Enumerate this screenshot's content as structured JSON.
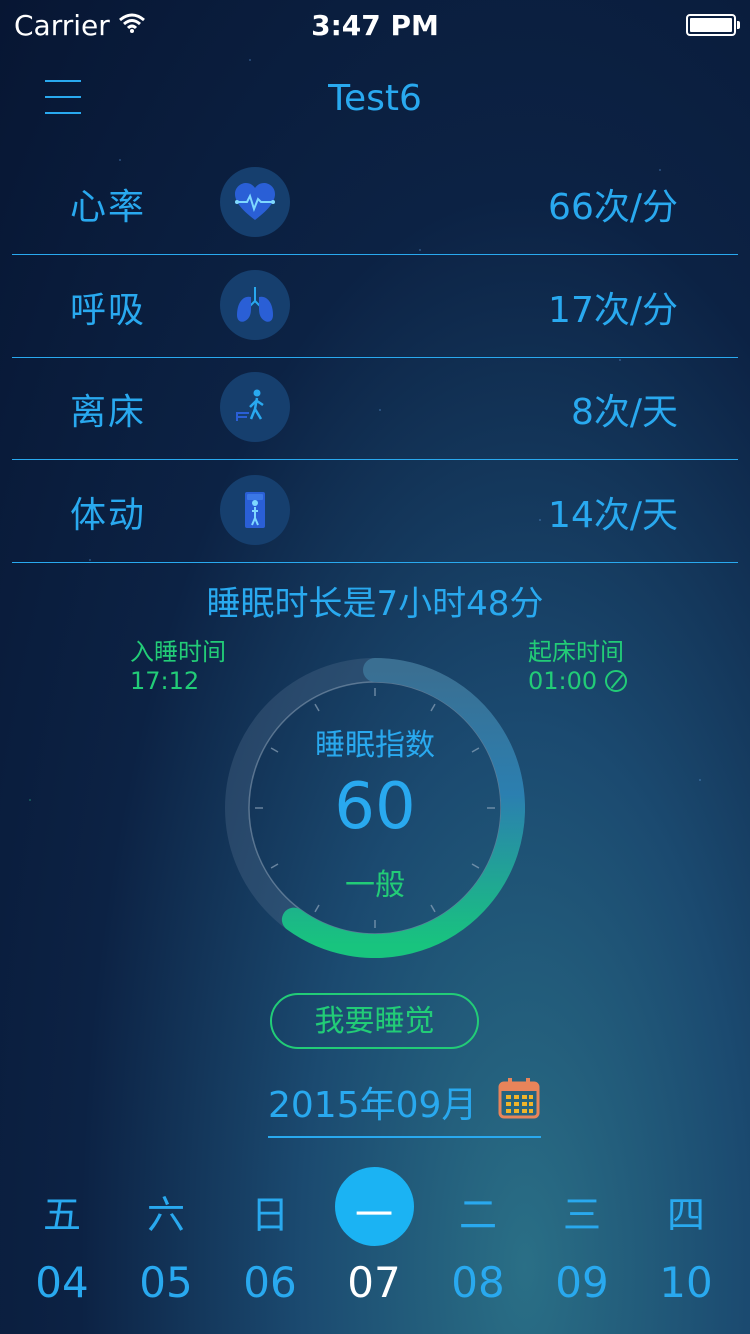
{
  "status": {
    "carrier": "Carrier",
    "time": "3:47 PM"
  },
  "nav": {
    "title": "Test6"
  },
  "metrics": [
    {
      "label": "心率",
      "icon": "heart-icon",
      "value": "66次/分"
    },
    {
      "label": "呼吸",
      "icon": "lungs-icon",
      "value": "17次/分"
    },
    {
      "label": "离床",
      "icon": "walking-person-icon",
      "value": "8次/天"
    },
    {
      "label": "体动",
      "icon": "person-in-bed-icon",
      "value": "14次/天"
    }
  ],
  "sleep": {
    "duration": "睡眠时长是7小时48分",
    "bedtime_label": "入睡时间",
    "bedtime": "17:12",
    "wake_label": "起床时间",
    "wake_time": "01:00"
  },
  "gauge": {
    "title": "睡眠指数",
    "score": "60",
    "grade": "一般",
    "score_value": 60,
    "max": 100
  },
  "sleep_button": "我要睡觉",
  "month": "2015年09月",
  "week": [
    {
      "dow": "五",
      "day": "04"
    },
    {
      "dow": "六",
      "day": "05"
    },
    {
      "dow": "日",
      "day": "06"
    },
    {
      "dow": "一",
      "day": "07",
      "selected": true
    },
    {
      "dow": "二",
      "day": "08"
    },
    {
      "dow": "三",
      "day": "09"
    },
    {
      "dow": "四",
      "day": "10"
    }
  ],
  "colors": {
    "accent": "#29a9ef",
    "green": "#22cc77",
    "selected": "#1bb3f3"
  }
}
